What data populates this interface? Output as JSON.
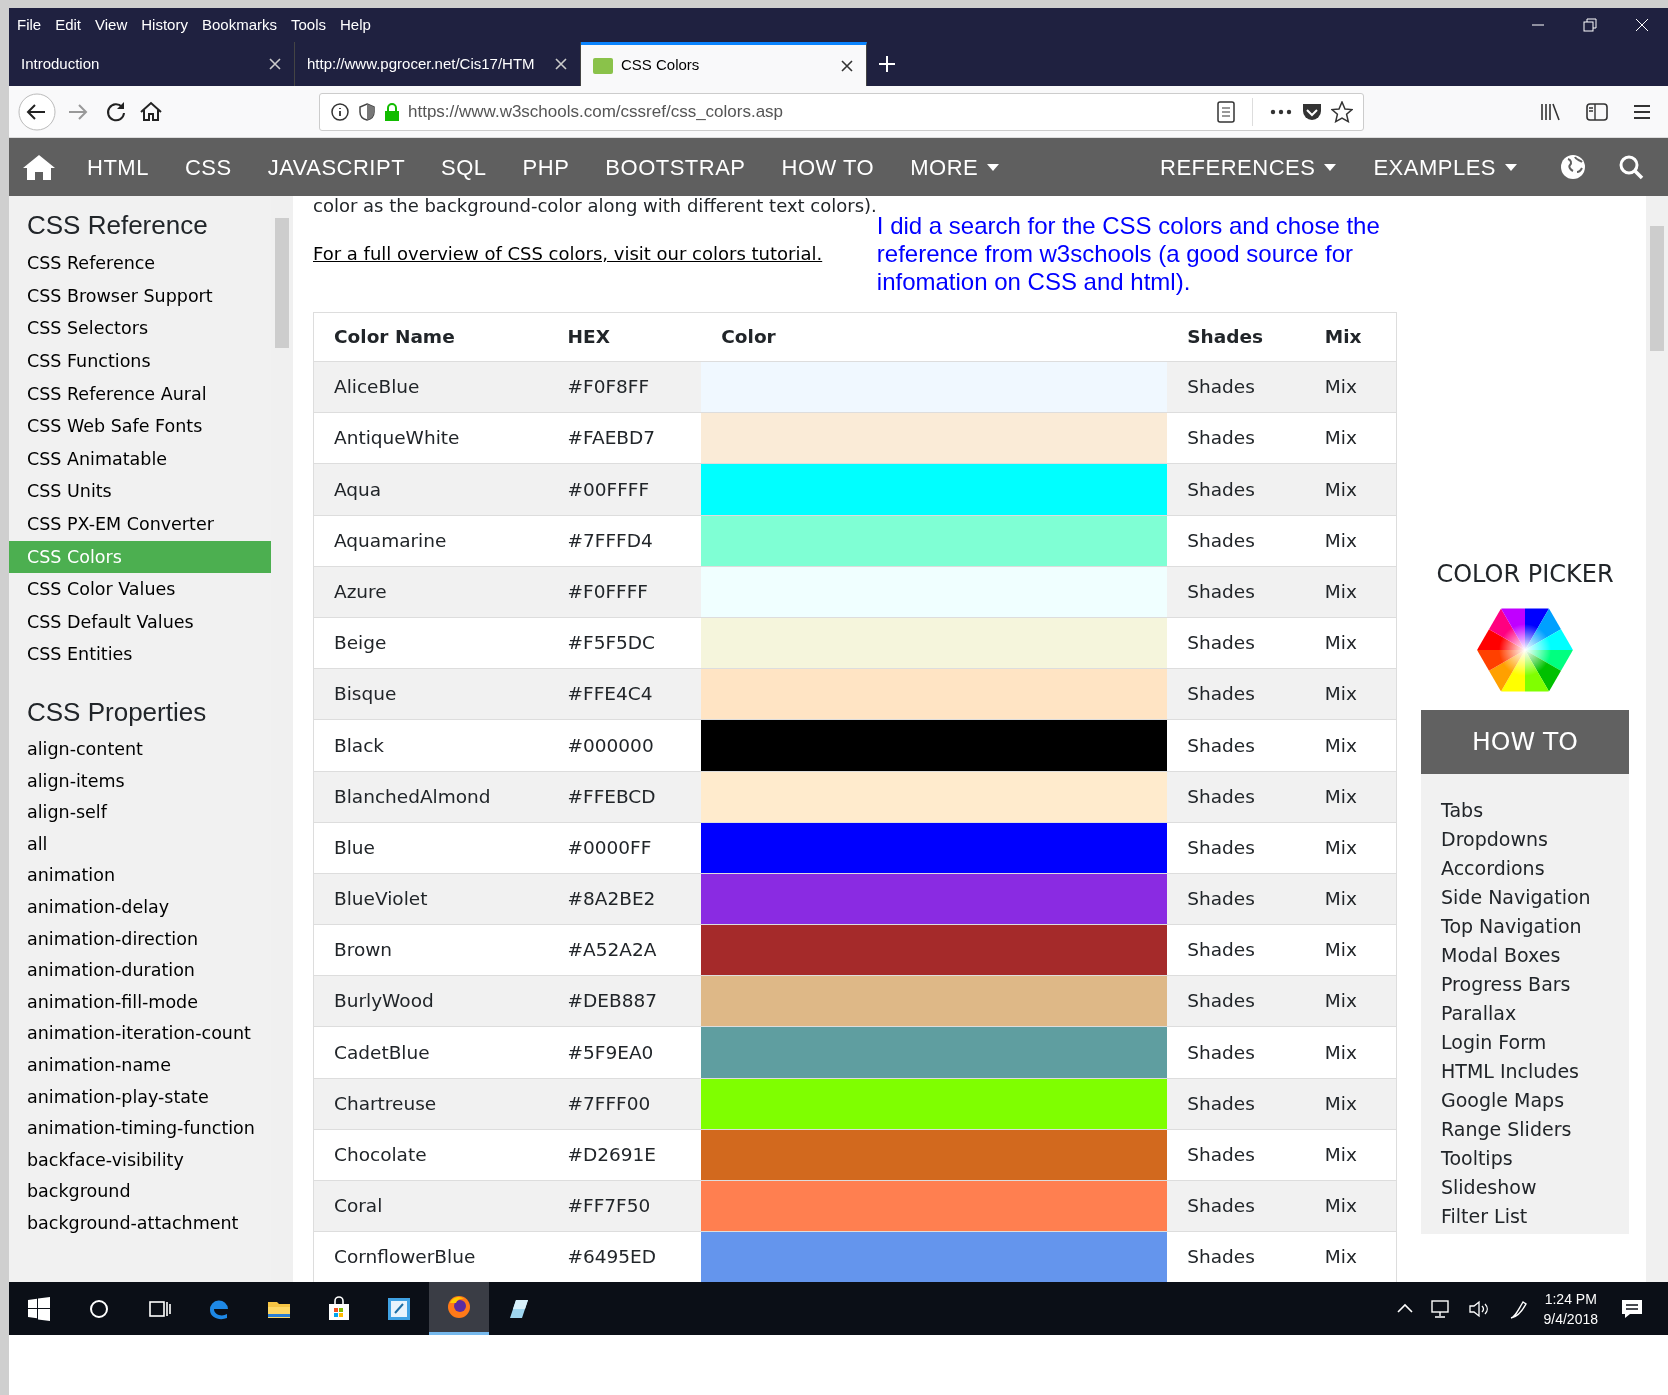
{
  "menu_bar": [
    "File",
    "Edit",
    "View",
    "History",
    "Bookmarks",
    "Tools",
    "Help"
  ],
  "tabs": [
    {
      "label": "Introduction",
      "selected": false,
      "favicon": false
    },
    {
      "label": "http://www.pgrocer.net/Cis17/HTM",
      "selected": false,
      "favicon": false
    },
    {
      "label": "CSS Colors",
      "selected": true,
      "favicon": true
    }
  ],
  "address_bar": {
    "url": "https://www.w3schools.com/cssref/css_colors.asp"
  },
  "site_nav": {
    "items": [
      {
        "label": "HTML",
        "dropdown": false
      },
      {
        "label": "CSS",
        "dropdown": false
      },
      {
        "label": "JAVASCRIPT",
        "dropdown": false
      },
      {
        "label": "SQL",
        "dropdown": false
      },
      {
        "label": "PHP",
        "dropdown": false
      },
      {
        "label": "BOOTSTRAP",
        "dropdown": false
      },
      {
        "label": "HOW TO",
        "dropdown": false
      },
      {
        "label": "MORE",
        "dropdown": true
      }
    ],
    "right_items": [
      {
        "label": "REFERENCES",
        "dropdown": true
      },
      {
        "label": "EXAMPLES",
        "dropdown": true
      }
    ]
  },
  "sidebar": {
    "sections": [
      {
        "heading": "CSS Reference",
        "items": [
          {
            "label": "CSS Reference",
            "selected": false
          },
          {
            "label": "CSS Browser Support",
            "selected": false
          },
          {
            "label": "CSS Selectors",
            "selected": false
          },
          {
            "label": "CSS Functions",
            "selected": false
          },
          {
            "label": "CSS Reference Aural",
            "selected": false
          },
          {
            "label": "CSS Web Safe Fonts",
            "selected": false
          },
          {
            "label": "CSS Animatable",
            "selected": false
          },
          {
            "label": "CSS Units",
            "selected": false
          },
          {
            "label": "CSS PX-EM Converter",
            "selected": false
          },
          {
            "label": "CSS Colors",
            "selected": true
          },
          {
            "label": "CSS Color Values",
            "selected": false
          },
          {
            "label": "CSS Default Values",
            "selected": false
          },
          {
            "label": "CSS Entities",
            "selected": false
          }
        ]
      },
      {
        "heading": "CSS Properties",
        "items": [
          {
            "label": "align-content",
            "selected": false
          },
          {
            "label": "align-items",
            "selected": false
          },
          {
            "label": "align-self",
            "selected": false
          },
          {
            "label": "all",
            "selected": false
          },
          {
            "label": "animation",
            "selected": false
          },
          {
            "label": "animation-delay",
            "selected": false
          },
          {
            "label": "animation-direction",
            "selected": false
          },
          {
            "label": "animation-duration",
            "selected": false
          },
          {
            "label": "animation-fill-mode",
            "selected": false
          },
          {
            "label": "animation-iteration-count",
            "selected": false
          },
          {
            "label": "animation-name",
            "selected": false
          },
          {
            "label": "animation-play-state",
            "selected": false
          },
          {
            "label": "animation-timing-function",
            "selected": false
          },
          {
            "label": "backface-visibility",
            "selected": false
          },
          {
            "label": "background",
            "selected": false
          },
          {
            "label": "background-attachment",
            "selected": false
          }
        ]
      }
    ]
  },
  "content": {
    "intro_text": "color as the background-color along with different text colors).",
    "overview_link": "For a full overview of CSS colors, visit our colors tutorial.",
    "note": "I did a search for the CSS colors and chose the reference from w3schools (a good source for infomation on CSS and html).",
    "table": {
      "columns": [
        "Color Name",
        "HEX",
        "Color",
        "Shades",
        "Mix"
      ],
      "rows": [
        {
          "name": "AliceBlue",
          "hex": "#F0F8FF",
          "color": "#f0f8ff",
          "shades": "Shades",
          "mix": "Mix"
        },
        {
          "name": "AntiqueWhite",
          "hex": "#FAEBD7",
          "color": "#faebd7",
          "shades": "Shades",
          "mix": "Mix"
        },
        {
          "name": "Aqua",
          "hex": "#00FFFF",
          "color": "#00ffff",
          "shades": "Shades",
          "mix": "Mix"
        },
        {
          "name": "Aquamarine",
          "hex": "#7FFFD4",
          "color": "#7fffd4",
          "shades": "Shades",
          "mix": "Mix"
        },
        {
          "name": "Azure",
          "hex": "#F0FFFF",
          "color": "#f0ffff",
          "shades": "Shades",
          "mix": "Mix"
        },
        {
          "name": "Beige",
          "hex": "#F5F5DC",
          "color": "#f5f5dc",
          "shades": "Shades",
          "mix": "Mix"
        },
        {
          "name": "Bisque",
          "hex": "#FFE4C4",
          "color": "#ffe4c4",
          "shades": "Shades",
          "mix": "Mix"
        },
        {
          "name": "Black",
          "hex": "#000000",
          "color": "#000000",
          "shades": "Shades",
          "mix": "Mix"
        },
        {
          "name": "BlanchedAlmond",
          "hex": "#FFEBCD",
          "color": "#ffebcd",
          "shades": "Shades",
          "mix": "Mix"
        },
        {
          "name": "Blue",
          "hex": "#0000FF",
          "color": "#0000ff",
          "shades": "Shades",
          "mix": "Mix"
        },
        {
          "name": "BlueViolet",
          "hex": "#8A2BE2",
          "color": "#8a2be2",
          "shades": "Shades",
          "mix": "Mix"
        },
        {
          "name": "Brown",
          "hex": "#A52A2A",
          "color": "#a52a2a",
          "shades": "Shades",
          "mix": "Mix"
        },
        {
          "name": "BurlyWood",
          "hex": "#DEB887",
          "color": "#deb887",
          "shades": "Shades",
          "mix": "Mix"
        },
        {
          "name": "CadetBlue",
          "hex": "#5F9EA0",
          "color": "#5f9ea0",
          "shades": "Shades",
          "mix": "Mix"
        },
        {
          "name": "Chartreuse",
          "hex": "#7FFF00",
          "color": "#7fff00",
          "shades": "Shades",
          "mix": "Mix"
        },
        {
          "name": "Chocolate",
          "hex": "#D2691E",
          "color": "#d2691e",
          "shades": "Shades",
          "mix": "Mix"
        },
        {
          "name": "Coral",
          "hex": "#FF7F50",
          "color": "#ff7f50",
          "shades": "Shades",
          "mix": "Mix"
        },
        {
          "name": "CornflowerBlue",
          "hex": "#6495ED",
          "color": "#6495ed",
          "shades": "Shades",
          "mix": "Mix"
        }
      ]
    }
  },
  "right_panel": {
    "color_picker_title": "COLOR PICKER",
    "howto_title": "HOW TO",
    "howto_items": [
      "Tabs",
      "Dropdowns",
      "Accordions",
      "Side Navigation",
      "Top Navigation",
      "Modal Boxes",
      "Progress Bars",
      "Parallax",
      "Login Form",
      "HTML Includes",
      "Google Maps",
      "Range Sliders",
      "Tooltips",
      "Slideshow",
      "Filter List"
    ]
  },
  "taskbar": {
    "apps": [
      {
        "kind": "edge",
        "active": false
      },
      {
        "kind": "folder",
        "active": false
      },
      {
        "kind": "store",
        "active": false
      },
      {
        "kind": "notes",
        "active": false
      },
      {
        "kind": "firefox",
        "active": true
      },
      {
        "kind": "glass",
        "active": false
      }
    ],
    "time": "1:24 PM",
    "date": "9/4/2018"
  }
}
